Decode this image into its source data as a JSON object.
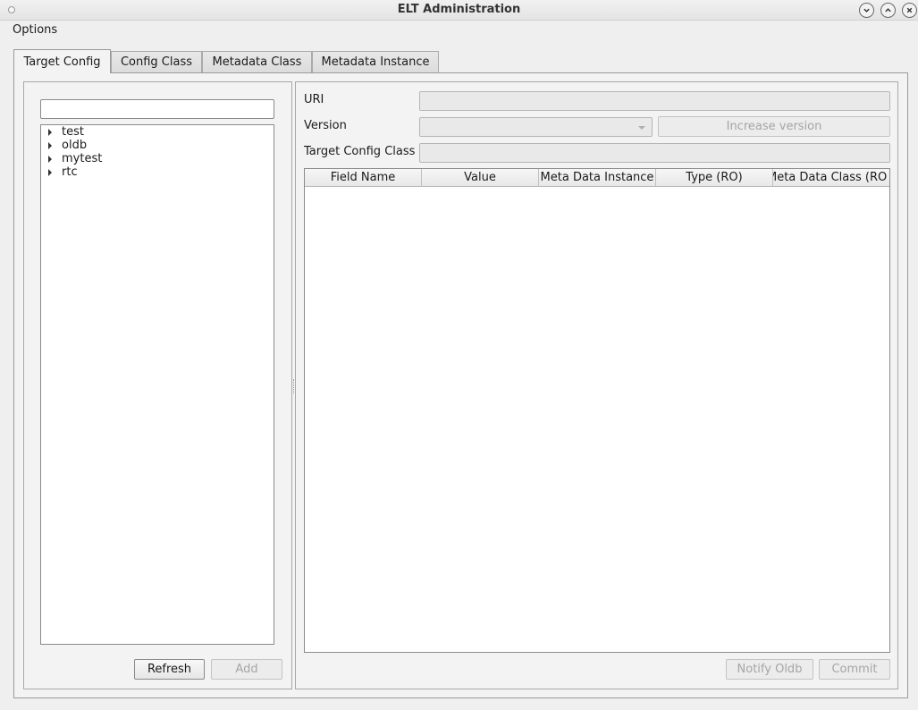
{
  "window": {
    "title": "ELT Administration"
  },
  "menubar": {
    "items": [
      {
        "label": "Options"
      }
    ]
  },
  "tabs": [
    {
      "label": "Target Config",
      "active": true
    },
    {
      "label": "Config Class",
      "active": false
    },
    {
      "label": "Metadata Class",
      "active": false
    },
    {
      "label": "Metadata Instance",
      "active": false
    }
  ],
  "left_panel": {
    "search": {
      "value": "",
      "placeholder": ""
    },
    "tree": [
      {
        "label": "test"
      },
      {
        "label": "oldb"
      },
      {
        "label": "mytest"
      },
      {
        "label": "rtc"
      }
    ],
    "buttons": {
      "refresh": "Refresh",
      "add": "Add"
    }
  },
  "right_panel": {
    "uri_label": "URI",
    "uri_value": "",
    "version_label": "Version",
    "version_value": "",
    "increase_version_label": "Increase version",
    "target_config_class_label": "Target Config Class",
    "target_config_class_value": "",
    "table": {
      "columns": [
        "Field Name",
        "Value",
        "Meta Data Instance",
        "Type (RO)",
        "Meta Data Class (RO"
      ],
      "rows": []
    },
    "buttons": {
      "notify_oldb": "Notify Oldb",
      "commit": "Commit"
    }
  },
  "icons": {
    "window_menu": "window-menu-icon",
    "minimize": "chevron-down-icon",
    "maximize": "chevron-up-icon",
    "close": "close-icon",
    "tree_expand": "triangle-right-icon",
    "combo": "dropdown-arrow-icon"
  }
}
